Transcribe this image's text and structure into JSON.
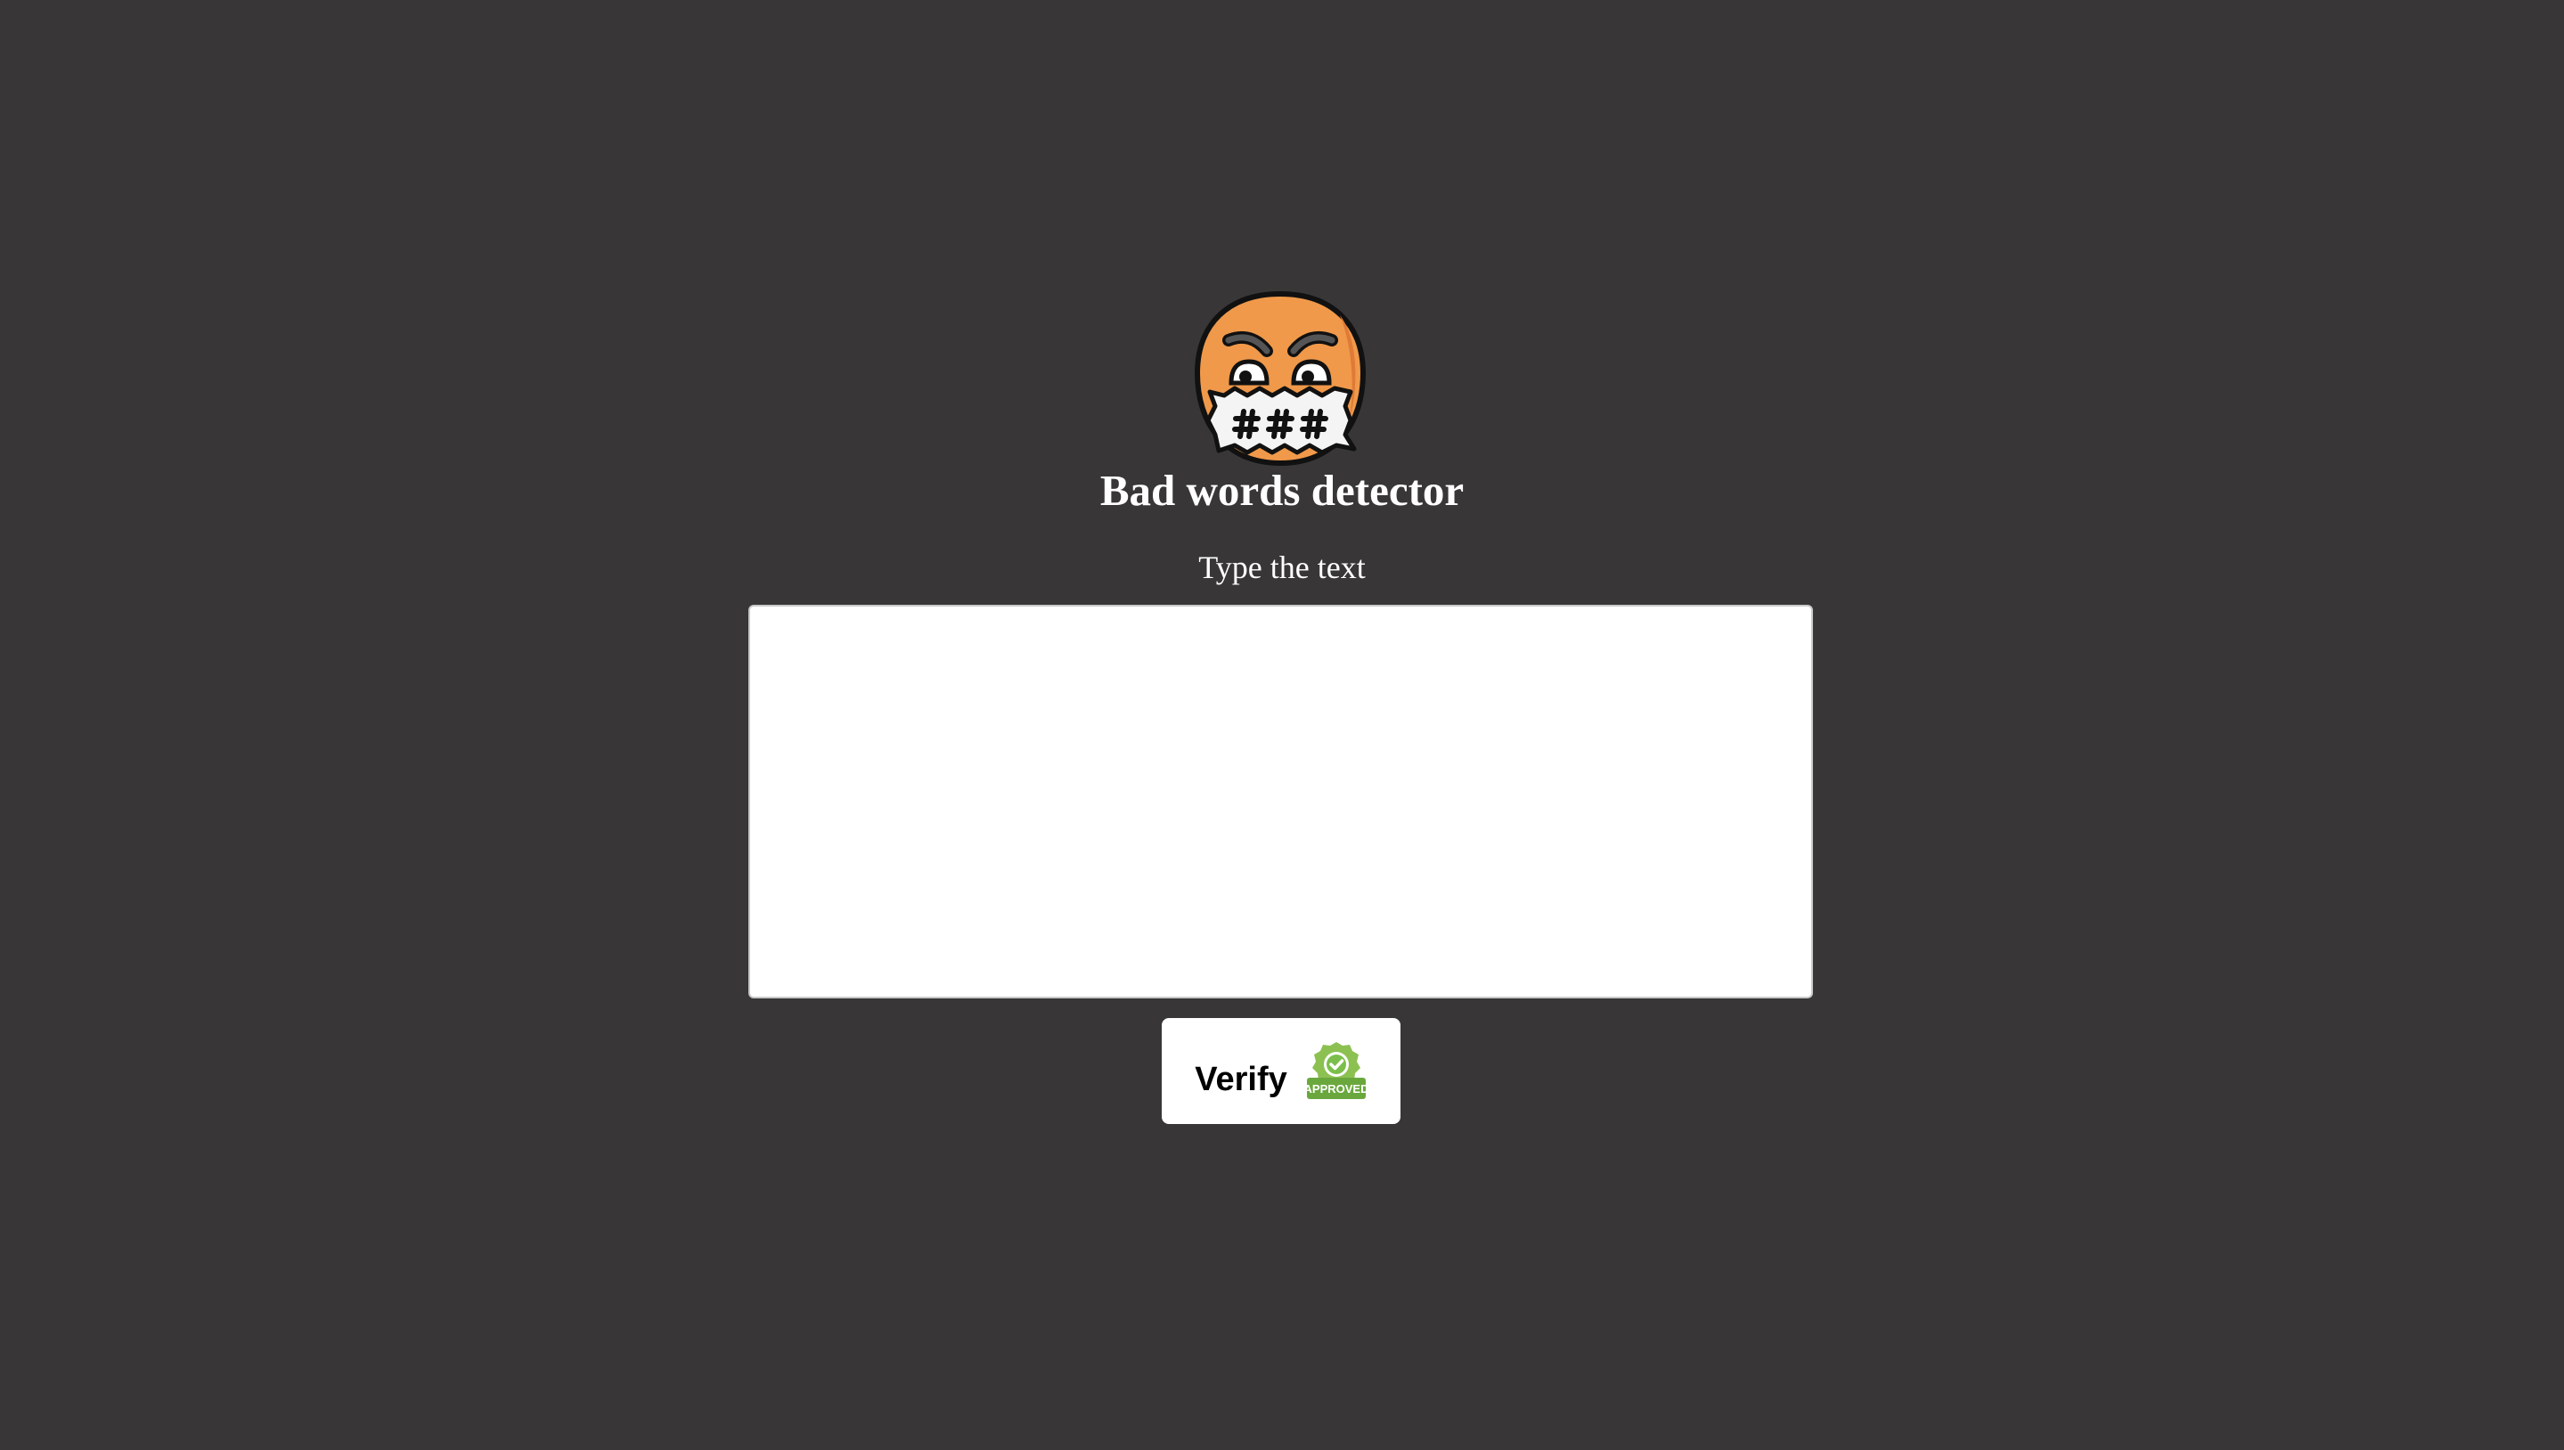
{
  "app": {
    "title": "Bad words detector",
    "logo_icon": "censored-face-icon"
  },
  "form": {
    "label": "Type the text",
    "input_value": "",
    "input_placeholder": "",
    "verify_label": "Verify",
    "verify_icon": "approved-badge-icon",
    "badge_text": "APPROVED"
  },
  "colors": {
    "background": "#383637",
    "face": "#f0994a",
    "badge_green": "#7bbf4a"
  }
}
